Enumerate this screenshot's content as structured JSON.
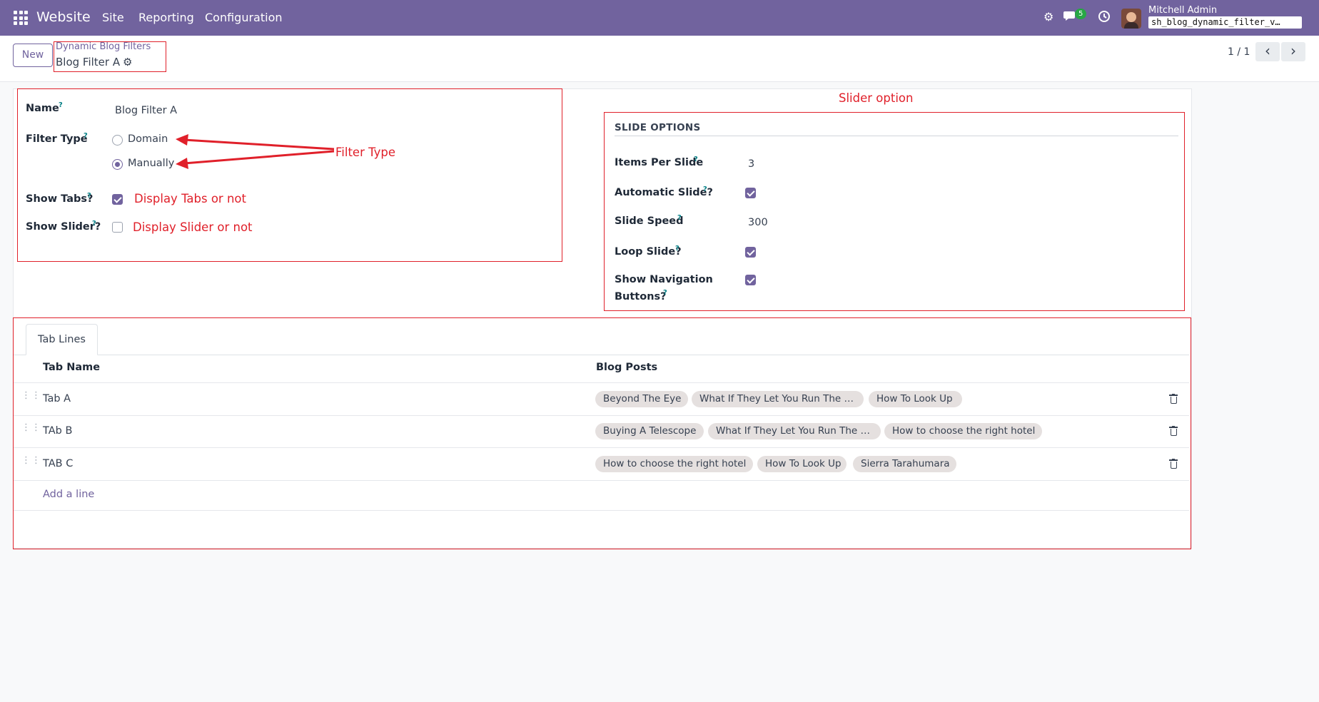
{
  "navbar": {
    "app_name": "Website",
    "menu": [
      "Site",
      "Reporting",
      "Configuration"
    ],
    "messages_count": "5",
    "user_name": "Mitchell Admin",
    "database": "sh_blog_dynamic_filter_v…",
    "icons": [
      "apps-icon",
      "bug-icon",
      "chat-icon",
      "clock-icon"
    ],
    "brand_color": "#71639e"
  },
  "control_panel": {
    "new_label": "New",
    "breadcrumb_parent": "Dynamic Blog Filters",
    "breadcrumb_current": "Blog Filter A",
    "pager": "1 / 1"
  },
  "form": {
    "name_label": "Name",
    "name_value": "Blog Filter A",
    "filter_type_label": "Filter Type",
    "filter_type_options": [
      "Domain",
      "Manually"
    ],
    "filter_type_selected": "Manually",
    "show_tabs_label": "Show Tabs?",
    "show_tabs": true,
    "show_slider_label": "Show Slider?",
    "show_slider": false,
    "help_mark": "?",
    "slide_options": {
      "title": "SLIDE OPTIONS",
      "items_per_slide_label": "Items Per Slide",
      "items_per_slide": "3",
      "automatic_slide_label": "Automatic Slide?",
      "automatic_slide": true,
      "slide_speed_label": "Slide Speed",
      "slide_speed": "300",
      "loop_slide_label": "Loop Slide?",
      "loop_slide": true,
      "show_nav_label_1": "Show Navigation",
      "show_nav_label_2": "Buttons?",
      "show_nav_buttons": true
    }
  },
  "annotations": {
    "filter_type": "Filter Type",
    "show_tabs": "Display Tabs or not",
    "show_slider": "Display Slider or not",
    "slider_option": "Slider option",
    "color": "#e0202a"
  },
  "notebook": {
    "tab_label": "Tab Lines",
    "columns": [
      "Tab Name",
      "Blog Posts"
    ],
    "rows": [
      {
        "name": "Tab A",
        "posts": [
          "Beyond The Eye",
          "What If They Let You Run The …",
          "How To Look Up"
        ]
      },
      {
        "name": "TAb B",
        "posts": [
          "Buying A Telescope",
          "What If They Let You Run The …",
          "How to choose the right hotel"
        ]
      },
      {
        "name": "TAB C",
        "posts": [
          "How to choose the right hotel",
          "How To Look Up",
          "Sierra Tarahumara"
        ]
      }
    ],
    "add_line": "Add a line"
  }
}
